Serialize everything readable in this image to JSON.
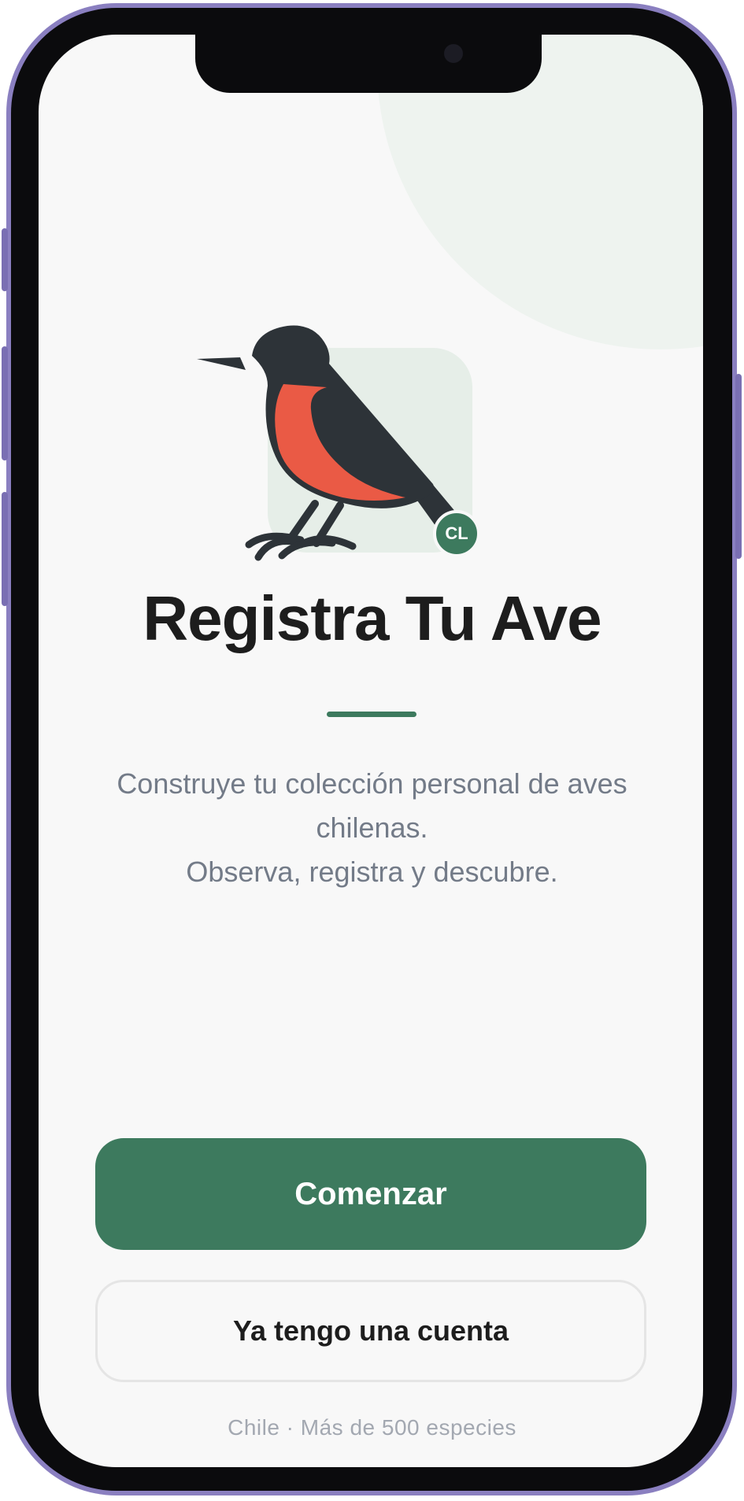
{
  "app": {
    "title": "Registra Tu Ave",
    "description_line1": "Construye tu colección personal de aves chilenas.",
    "description_line2": "Observa, registra y descubre.",
    "badge_text": "CL",
    "logo_icon": "bird-icon"
  },
  "actions": {
    "primary_label": "Comenzar",
    "secondary_label": "Ya tengo una cuenta"
  },
  "footer": {
    "text": "Chile · Más de 500 especies"
  },
  "colors": {
    "primary": "#3d7a5e",
    "background": "#f8f8f8",
    "title": "#1d1d1d",
    "description": "#737b88",
    "bird_body": "#2d3338",
    "bird_chest": "#ea5a45",
    "frame": "#8a7fc0"
  }
}
